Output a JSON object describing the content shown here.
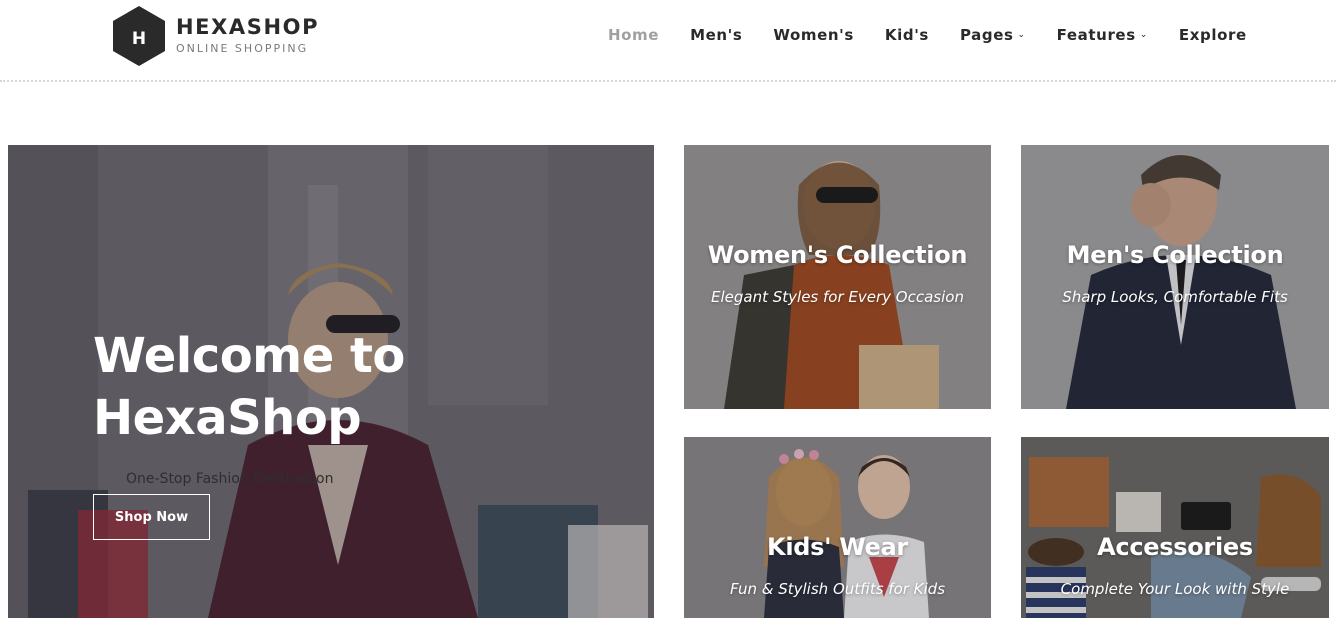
{
  "header": {
    "logo": {
      "letter": "H",
      "name": "HEXASHOP",
      "tagline": "ONLINE SHOPPING"
    },
    "nav": [
      {
        "label": "Home",
        "active": true,
        "dropdown": false
      },
      {
        "label": "Men's",
        "active": false,
        "dropdown": false
      },
      {
        "label": "Women's",
        "active": false,
        "dropdown": false
      },
      {
        "label": "Kid's",
        "active": false,
        "dropdown": false
      },
      {
        "label": "Pages",
        "active": false,
        "dropdown": true
      },
      {
        "label": "Features",
        "active": false,
        "dropdown": true
      },
      {
        "label": "Explore",
        "active": false,
        "dropdown": false
      }
    ],
    "caret": "⌄"
  },
  "hero": {
    "title_line1": "Welcome to",
    "title_line2": "HexaShop",
    "subtitle": "One-Stop Fashion Destination",
    "button_label": "Shop Now"
  },
  "categories": [
    {
      "title": "Women's Collection",
      "subtitle": "Elegant Styles for Every Occasion"
    },
    {
      "title": "Men's Collection",
      "subtitle": "Sharp Looks, Comfortable Fits"
    },
    {
      "title": "Kids' Wear",
      "subtitle": "Fun & Stylish Outfits for Kids"
    },
    {
      "title": "Accessories",
      "subtitle": "Complete Your Look with Style"
    }
  ],
  "colors": {
    "text_dark": "#2a2a2a",
    "nav_active": "#a0a0a0",
    "white": "#ffffff"
  }
}
